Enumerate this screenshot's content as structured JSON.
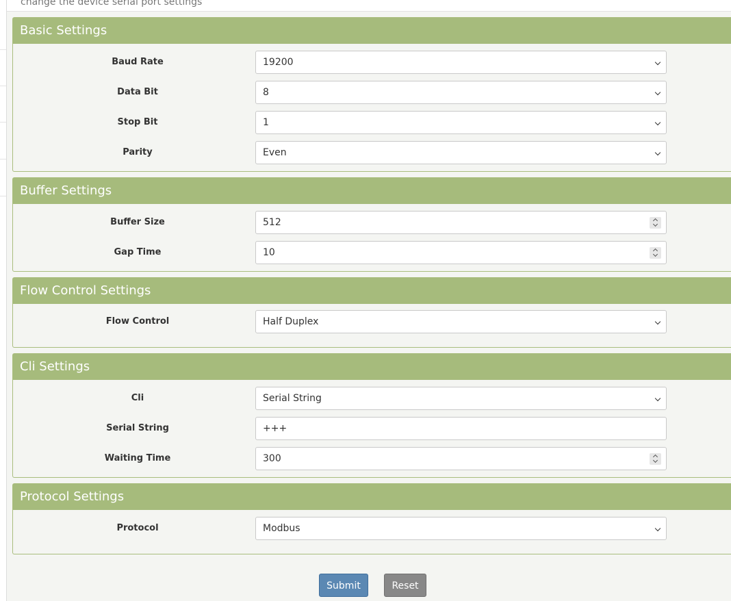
{
  "page": {
    "description": "change the device serial port settings"
  },
  "basic": {
    "title": "Basic Settings",
    "baud_rate": {
      "label": "Baud Rate",
      "value": "19200"
    },
    "data_bit": {
      "label": "Data Bit",
      "value": "8"
    },
    "stop_bit": {
      "label": "Stop Bit",
      "value": "1"
    },
    "parity": {
      "label": "Parity",
      "value": "Even"
    }
  },
  "buffer": {
    "title": "Buffer Settings",
    "buffer_size": {
      "label": "Buffer Size",
      "value": "512"
    },
    "gap_time": {
      "label": "Gap Time",
      "value": "10"
    }
  },
  "flow": {
    "title": "Flow Control Settings",
    "flow_control": {
      "label": "Flow Control",
      "value": "Half Duplex"
    }
  },
  "cli": {
    "title": "Cli Settings",
    "cli": {
      "label": "Cli",
      "value": "Serial String"
    },
    "serial_string": {
      "label": "Serial String",
      "value": "+++"
    },
    "waiting_time": {
      "label": "Waiting Time",
      "value": "300"
    }
  },
  "protocol": {
    "title": "Protocol Settings",
    "protocol": {
      "label": "Protocol",
      "value": "Modbus"
    }
  },
  "actions": {
    "submit_label": "Submit",
    "reset_label": "Reset"
  },
  "colors": {
    "panel_header": "#a6bb7c",
    "submit": "#5b88b3",
    "reset": "#888888"
  }
}
